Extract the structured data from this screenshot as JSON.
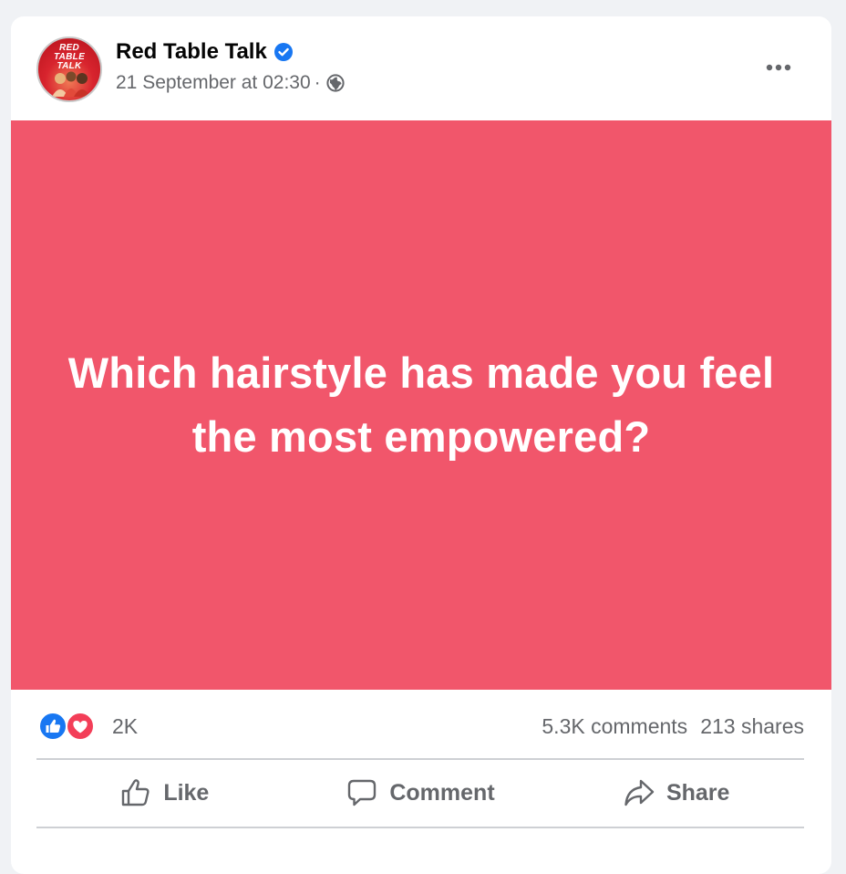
{
  "post": {
    "avatar_logo": [
      "RED",
      "TABLE",
      "TALK"
    ],
    "page_name": "Red Table Talk",
    "timestamp": "21 September at 02:30",
    "separator": "·",
    "visibility_icon": "globe-icon",
    "verified_icon": "verified-badge-icon",
    "more_icon": "more-options-icon",
    "background_color": "#f1566b",
    "text": "Which hairstyle has made you feel the most empowered?"
  },
  "stats": {
    "reactions": [
      "like",
      "love"
    ],
    "reaction_count": "2K",
    "comments": "5.3K comments",
    "shares": "213 shares"
  },
  "actions": {
    "like": "Like",
    "comment": "Comment",
    "share": "Share"
  },
  "colors": {
    "accent": "#1877f2",
    "love": "#f33e58",
    "muted_text": "#65676b"
  }
}
